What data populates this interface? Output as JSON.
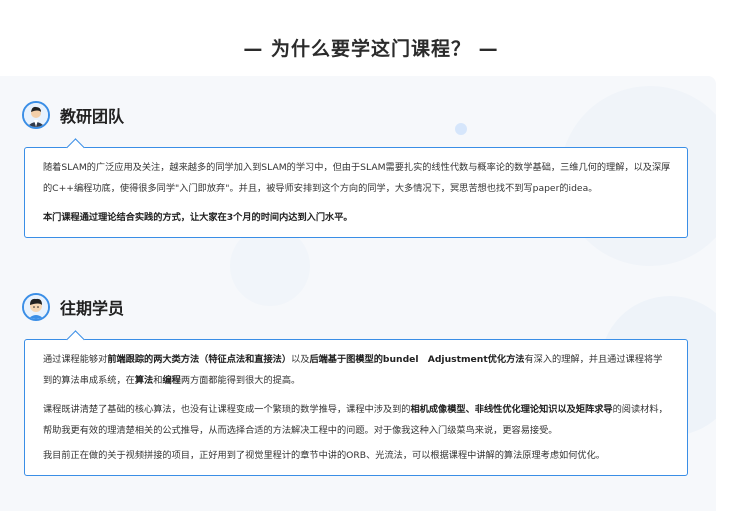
{
  "page_title": "— 为什么要学这门课程？ —",
  "section1": {
    "title": "教研团队",
    "paragraph1": "随着SLAM的广泛应用及关注，越来越多的同学加入到SLAM的学习中，但由于SLAM需要扎实的线性代数与概率论的数学基础，三维几何的理解，以及深厚的C++编程功底，使得很多同学\"入门即放弃\"。并且，被导师安排到这个方向的同学，大多情况下，冥思苦想也找不到写paper的idea。",
    "paragraph2": "本门课程通过理论结合实践的方式，让大家在3个月的时间内达到入门水平。"
  },
  "section2": {
    "title": "往期学员",
    "p1_a": "通过课程能够对",
    "p1_b": "前端跟踪的两大类方法（特征点法和直接法）",
    "p1_c": "以及",
    "p1_d": "后端基于图模型的bundel　Adjustment优化方法",
    "p1_e": "有深入的理解，并且通过课程将学到的算法串成系统，在",
    "p1_f": "算法",
    "p1_g": "和",
    "p1_h": "编程",
    "p1_i": "两方面都能得到很大的提高。",
    "p2_a": "课程既讲清楚了基础的核心算法，也没有让课程变成一个繁琐的数学推导，课程中涉及到的",
    "p2_b": "相机成像模型、非线性优化理论知识以及矩阵求导",
    "p2_c": "的阅读材料，帮助我更有效的理清楚相关的公式推导，从而选择合适的方法解决工程中的问题。对于像我这种入门级菜鸟来说，更容易接受。",
    "p3": "我目前正在做的关于视频拼接的项目，正好用到了视觉里程计的章节中讲的ORB、光流法，可以根据课程中讲解的算法原理考虑如何优化。"
  },
  "colors": {
    "accent": "#3a8ee6",
    "panel_bg": "#f6f8fb"
  }
}
